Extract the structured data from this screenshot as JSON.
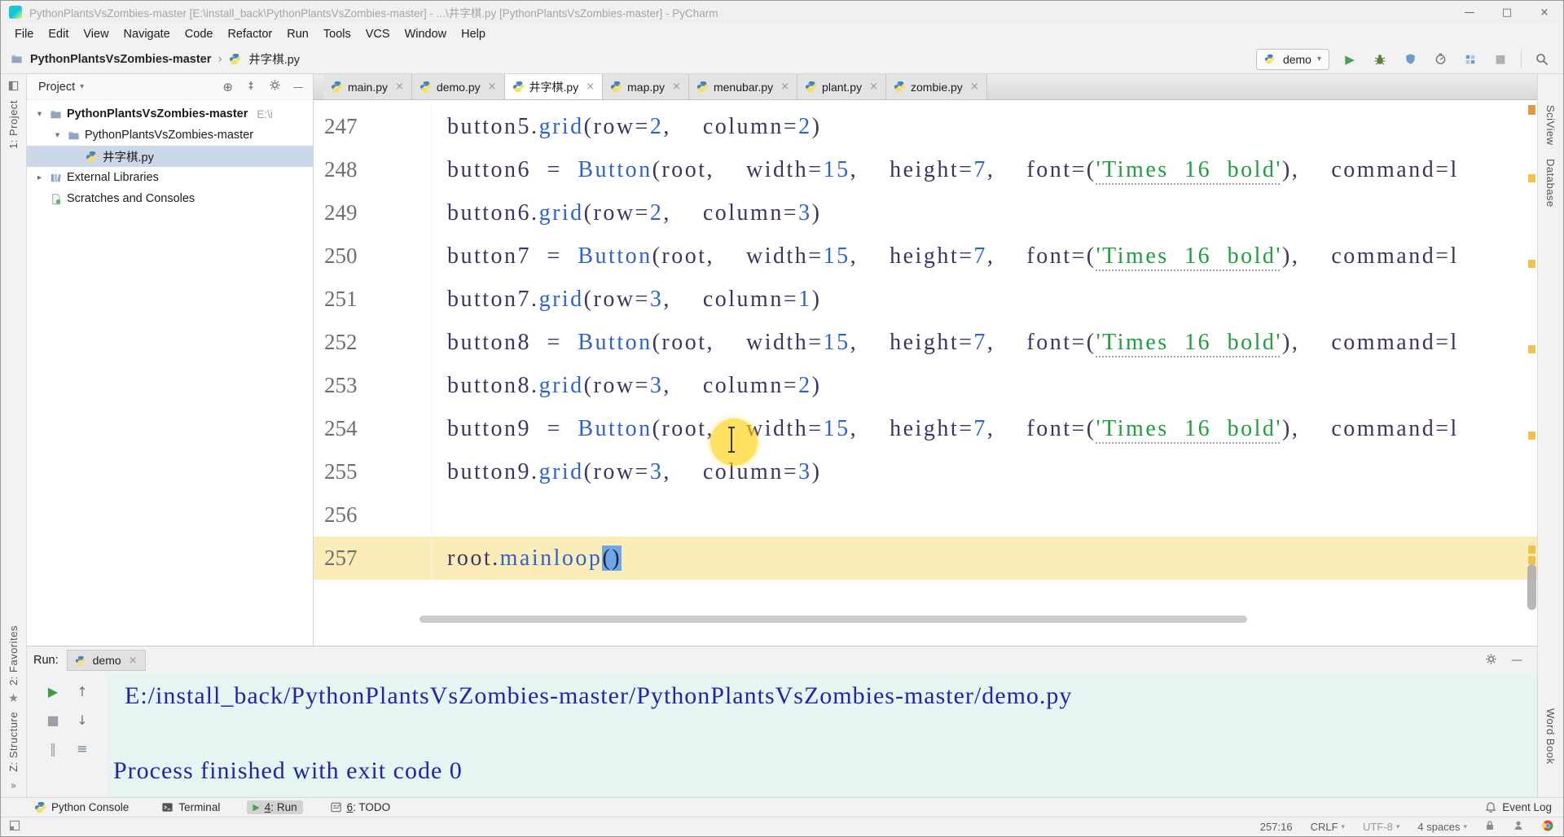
{
  "window": {
    "title": "PythonPlantsVsZombies-master [E:\\install_back\\PythonPlantsVsZombies-master] - ...\\井字棋.py [PythonPlantsVsZombies-master] - PyCharm",
    "minimize": "—",
    "maximize": "□",
    "close": "×"
  },
  "menu": [
    "File",
    "Edit",
    "View",
    "Navigate",
    "Code",
    "Refactor",
    "Run",
    "Tools",
    "VCS",
    "Window",
    "Help"
  ],
  "toolbar": {
    "breadcrumb_root": "PythonPlantsVsZombies-master",
    "breadcrumb_sep": "›",
    "breadcrumb_file": "井字棋.py",
    "run_config": "demo",
    "icons": [
      {
        "name": "run-icon",
        "type": "play"
      },
      {
        "name": "debug-icon",
        "type": "bug"
      },
      {
        "name": "coverage-icon",
        "type": "shield"
      },
      {
        "name": "profiler-icon",
        "type": "clock"
      },
      {
        "name": "concurrency-icon",
        "type": "grid"
      },
      {
        "name": "stop-icon",
        "type": "stopgray"
      },
      {
        "name": "search-everywhere-icon",
        "type": "search"
      }
    ]
  },
  "glyphs": {
    "close": "×",
    "caret_down": "▾",
    "caret_right": "▸",
    "dropdown": "▾",
    "play": "▶",
    "stop": "■",
    "pause": "‖",
    "up": "↑",
    "down": "↓",
    "restore": "≡",
    "star": "★",
    "more": "»",
    "minus": "—",
    "locate": "⊕"
  },
  "stripes": {
    "left_top": "1: Project",
    "left_bottom": [
      "2: Favorites",
      "Z: Structure"
    ],
    "right": [
      "SciView",
      "Database"
    ],
    "right_bottom": "Word Book"
  },
  "project": {
    "header": "Project",
    "tree": [
      {
        "label": "PythonPlantsVsZombies-master",
        "hint": "E:\\i",
        "caret": "expanded",
        "icon": "folder",
        "bold": true,
        "indent": 0
      },
      {
        "label": "PythonPlantsVsZombies-master",
        "caret": "expanded",
        "icon": "folder",
        "indent": 1
      },
      {
        "label": "井字棋.py",
        "icon": "python",
        "indent": 2,
        "selected": true
      },
      {
        "label": "External Libraries",
        "caret": "collapsed",
        "icon": "library",
        "indent": 0
      },
      {
        "label": "Scratches and Consoles",
        "icon": "scratch",
        "indent": 0
      }
    ]
  },
  "tabs": [
    {
      "label": "main.py"
    },
    {
      "label": "demo.py"
    },
    {
      "label": "井字棋.py",
      "active": true
    },
    {
      "label": "map.py"
    },
    {
      "label": "menubar.py"
    },
    {
      "label": "plant.py"
    },
    {
      "label": "zombie.py"
    }
  ],
  "editor": {
    "lines": [
      {
        "num": "247",
        "tokens": [
          [
            "button5.",
            "id"
          ],
          [
            "grid",
            "fn"
          ],
          [
            "(",
            "id"
          ],
          [
            "row=",
            "id"
          ],
          [
            "2",
            "num"
          ],
          [
            ",  ",
            "id"
          ],
          [
            "column=",
            "id"
          ],
          [
            "2",
            "num"
          ],
          [
            ")",
            "id"
          ]
        ]
      },
      {
        "num": "248",
        "tokens": [
          [
            "button6 = ",
            "id"
          ],
          [
            "Button",
            "fn"
          ],
          [
            "(",
            "id"
          ],
          [
            "root",
            "id"
          ],
          [
            ",  ",
            "id"
          ],
          [
            "width=",
            "id"
          ],
          [
            "15",
            "num"
          ],
          [
            ",  ",
            "id"
          ],
          [
            "height=",
            "id"
          ],
          [
            "7",
            "num"
          ],
          [
            ",  ",
            "id"
          ],
          [
            "font=(",
            "id"
          ],
          [
            "'Times 16 bold'",
            "str"
          ],
          [
            ")",
            "id"
          ],
          [
            ",  ",
            "id"
          ],
          [
            "command=l",
            "id"
          ]
        ]
      },
      {
        "num": "249",
        "tokens": [
          [
            "button6.",
            "id"
          ],
          [
            "grid",
            "fn"
          ],
          [
            "(",
            "id"
          ],
          [
            "row=",
            "id"
          ],
          [
            "2",
            "num"
          ],
          [
            ",  ",
            "id"
          ],
          [
            "column=",
            "id"
          ],
          [
            "3",
            "num"
          ],
          [
            ")",
            "id"
          ]
        ]
      },
      {
        "num": "250",
        "tokens": [
          [
            "button7 = ",
            "id"
          ],
          [
            "Button",
            "fn"
          ],
          [
            "(",
            "id"
          ],
          [
            "root",
            "id"
          ],
          [
            ",  ",
            "id"
          ],
          [
            "width=",
            "id"
          ],
          [
            "15",
            "num"
          ],
          [
            ",  ",
            "id"
          ],
          [
            "height=",
            "id"
          ],
          [
            "7",
            "num"
          ],
          [
            ",  ",
            "id"
          ],
          [
            "font=(",
            "id"
          ],
          [
            "'Times 16 bold'",
            "str"
          ],
          [
            ")",
            "id"
          ],
          [
            ",  ",
            "id"
          ],
          [
            "command=l",
            "id"
          ]
        ]
      },
      {
        "num": "251",
        "tokens": [
          [
            "button7.",
            "id"
          ],
          [
            "grid",
            "fn"
          ],
          [
            "(",
            "id"
          ],
          [
            "row=",
            "id"
          ],
          [
            "3",
            "num"
          ],
          [
            ",  ",
            "id"
          ],
          [
            "column=",
            "id"
          ],
          [
            "1",
            "num"
          ],
          [
            ")",
            "id"
          ]
        ]
      },
      {
        "num": "252",
        "tokens": [
          [
            "button8 = ",
            "id"
          ],
          [
            "Button",
            "fn"
          ],
          [
            "(",
            "id"
          ],
          [
            "root",
            "id"
          ],
          [
            ",  ",
            "id"
          ],
          [
            "width=",
            "id"
          ],
          [
            "15",
            "num"
          ],
          [
            ",  ",
            "id"
          ],
          [
            "height=",
            "id"
          ],
          [
            "7",
            "num"
          ],
          [
            ",  ",
            "id"
          ],
          [
            "font=(",
            "id"
          ],
          [
            "'Times 16 bold'",
            "str"
          ],
          [
            ")",
            "id"
          ],
          [
            ",  ",
            "id"
          ],
          [
            "command=l",
            "id"
          ]
        ]
      },
      {
        "num": "253",
        "tokens": [
          [
            "button8.",
            "id"
          ],
          [
            "grid",
            "fn"
          ],
          [
            "(",
            "id"
          ],
          [
            "row=",
            "id"
          ],
          [
            "3",
            "num"
          ],
          [
            ",  ",
            "id"
          ],
          [
            "column=",
            "id"
          ],
          [
            "2",
            "num"
          ],
          [
            ")",
            "id"
          ]
        ]
      },
      {
        "num": "254",
        "tokens": [
          [
            "button9 = ",
            "id"
          ],
          [
            "Button",
            "fn"
          ],
          [
            "(",
            "id"
          ],
          [
            "root",
            "id"
          ],
          [
            ",  ",
            "id"
          ],
          [
            "width=",
            "id"
          ],
          [
            "15",
            "num"
          ],
          [
            ",  ",
            "id"
          ],
          [
            "height=",
            "id"
          ],
          [
            "7",
            "num"
          ],
          [
            ",  ",
            "id"
          ],
          [
            "font=(",
            "id"
          ],
          [
            "'Times 16 bold'",
            "str"
          ],
          [
            ")",
            "id"
          ],
          [
            ",  ",
            "id"
          ],
          [
            "command=l",
            "id"
          ]
        ]
      },
      {
        "num": "255",
        "tokens": [
          [
            "button9.",
            "id"
          ],
          [
            "grid",
            "fn"
          ],
          [
            "(",
            "id"
          ],
          [
            "row=",
            "id"
          ],
          [
            "3",
            "num"
          ],
          [
            ",  ",
            "id"
          ],
          [
            "column=",
            "id"
          ],
          [
            "3",
            "num"
          ],
          [
            ")",
            "id"
          ]
        ]
      },
      {
        "num": "256",
        "tokens": []
      },
      {
        "num": "257",
        "current": true,
        "tokens": [
          [
            "root.",
            "id"
          ],
          [
            "mainloop",
            "fn"
          ],
          [
            "()",
            "sel"
          ]
        ]
      }
    ]
  },
  "run": {
    "label": "Run:",
    "tab": "demo",
    "output_path": "E:/install_back/PythonPlantsVsZombies-master/PythonPlantsVsZombies-master/demo.py",
    "output_status": "Process finished with exit code 0",
    "toolbar": [
      {
        "name": "rerun-button",
        "glyph": "play",
        "tone": "green"
      },
      {
        "name": "stack-up-button",
        "glyph": "up",
        "tone": ""
      },
      {
        "name": "stop-button",
        "glyph": "stop",
        "tone": "gray"
      },
      {
        "name": "stack-down-button",
        "glyph": "down",
        "tone": ""
      },
      {
        "name": "pause-output-button",
        "glyph": "pause",
        "tone": "gray"
      },
      {
        "name": "restore-layout-button",
        "glyph": "restore",
        "tone": ""
      }
    ]
  },
  "bottom": {
    "items": [
      {
        "label": "Python Console",
        "icon": "python"
      },
      {
        "label": "Terminal",
        "icon": "terminal"
      },
      {
        "label": "4: Run",
        "icon": "run",
        "active": true,
        "mnemonic": true
      },
      {
        "label": "6: TODO",
        "icon": "todo",
        "mnemonic": true
      }
    ],
    "right": "Event Log"
  },
  "status": {
    "caret": "257:16",
    "line_ending": "CRLF",
    "encoding": "UTF-8",
    "indent": "4 spaces"
  },
  "colors": {
    "accent_blue": "#2d63cf",
    "string_green": "#1f9e3d",
    "current_line": "#fcedb8",
    "selection": "#6ea7e5",
    "console_text": "#1f26ad",
    "console_bg": "#e7f5f2",
    "warning_mark": "#f0c24b"
  }
}
